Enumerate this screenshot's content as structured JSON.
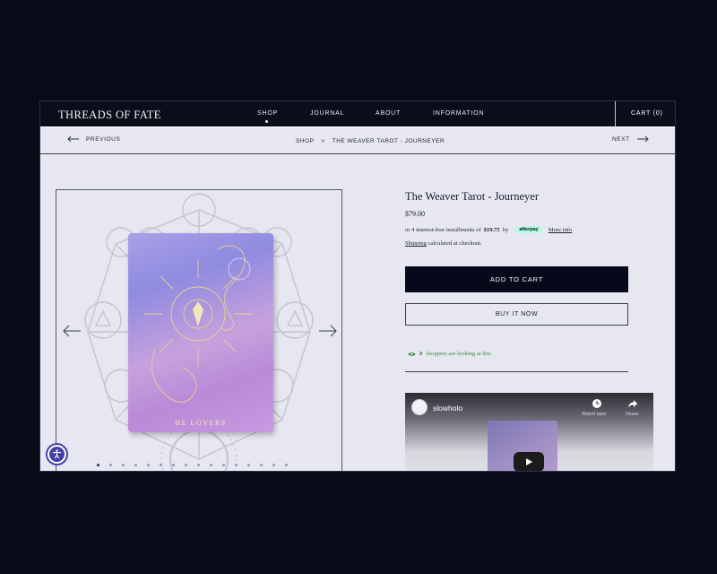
{
  "header": {
    "logo": "THREADS OF FATE",
    "nav": [
      "SHOP",
      "JOURNAL",
      "ABOUT",
      "INFORMATION"
    ],
    "active_nav": "SHOP",
    "cart_label": "CART (0)"
  },
  "subnav": {
    "previous": "PREVIOUS",
    "next": "NEXT",
    "breadcrumb": [
      "SHOP",
      ">",
      "THE WEAVER TAROT - JOURNEYER"
    ]
  },
  "gallery": {
    "card_caption": "HE LOVERS",
    "dot_count": 16,
    "active_dot": 0
  },
  "product": {
    "title": "The Weaver Tarot - Journeyer",
    "price": "$79.00",
    "installment_prefix": "or 4 interest-free installments of",
    "installment_amount": "$19.75",
    "installment_by": "by",
    "afterpay_label": "afterpay",
    "more_info": "More info",
    "shipping_link": "Shipping",
    "shipping_text": "calculated at checkout.",
    "add_to_cart": "ADD TO CART",
    "buy_now": "BUY IT NOW",
    "shoppers_count": "8",
    "shoppers_text": "shoppers are looking at this"
  },
  "video": {
    "channel": "slowholo",
    "watch_later": "Watch later",
    "share": "Share"
  },
  "colors": {
    "background": "#070b18",
    "page": "#e7e7f1",
    "header": "#0a0d1a",
    "button_dark": "#07091a",
    "accessibility": "#4442a8",
    "shoppers_green": "#3c8a3f"
  }
}
